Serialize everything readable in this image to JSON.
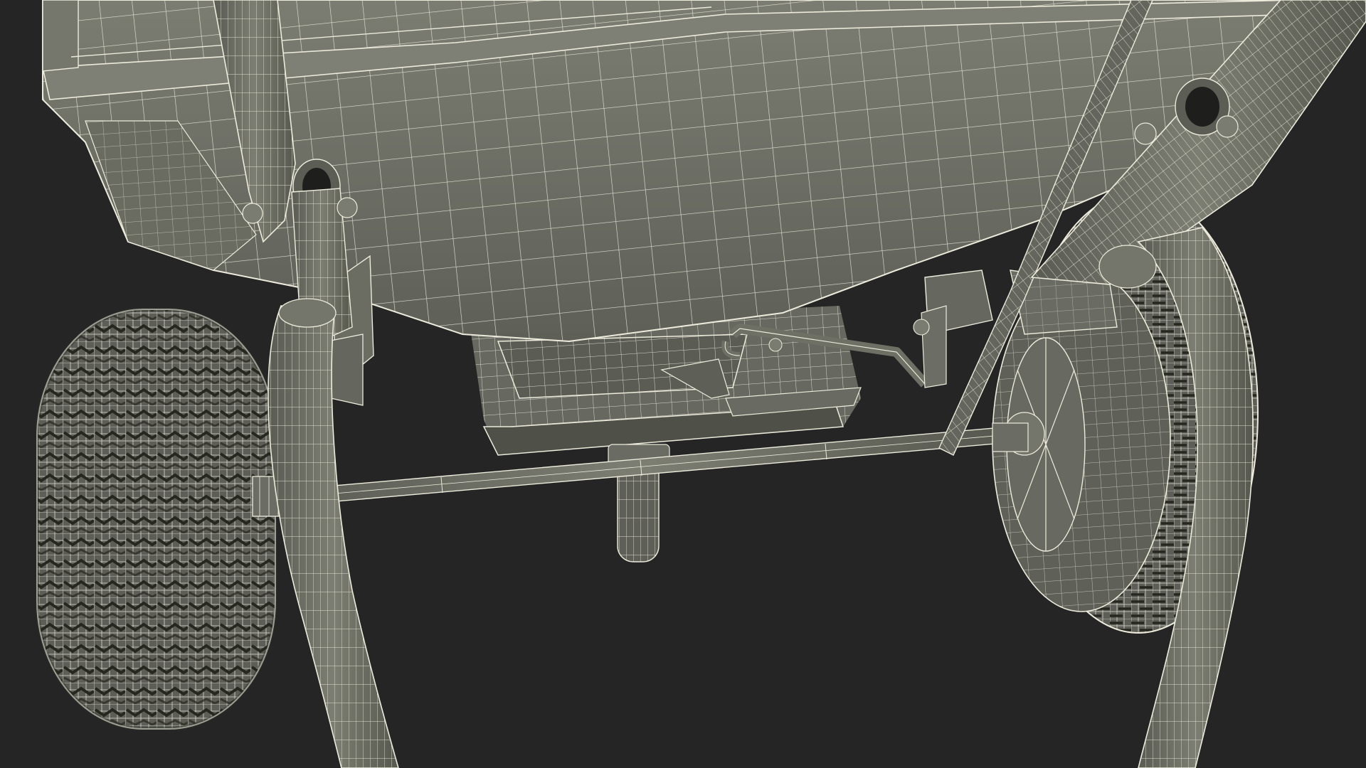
{
  "render": {
    "style": "wireframe-on-shaded",
    "background_color": "#252525",
    "surface_color": "#70726a",
    "surface_shadow_color": "#575950",
    "surface_light_color": "#858779",
    "wire_color": "#f1f0e4",
    "tire_color": "#5a5b54",
    "tread_dark_color": "#2e2f2b"
  },
  "subject": {
    "label": "",
    "parts": [
      "tub",
      "front-left-handle",
      "right-handle",
      "left-wheel",
      "right-wheel",
      "axle",
      "spreader-hopper",
      "spinner-disc",
      "linkage-rod",
      "mounting-brackets",
      "bolts"
    ]
  }
}
